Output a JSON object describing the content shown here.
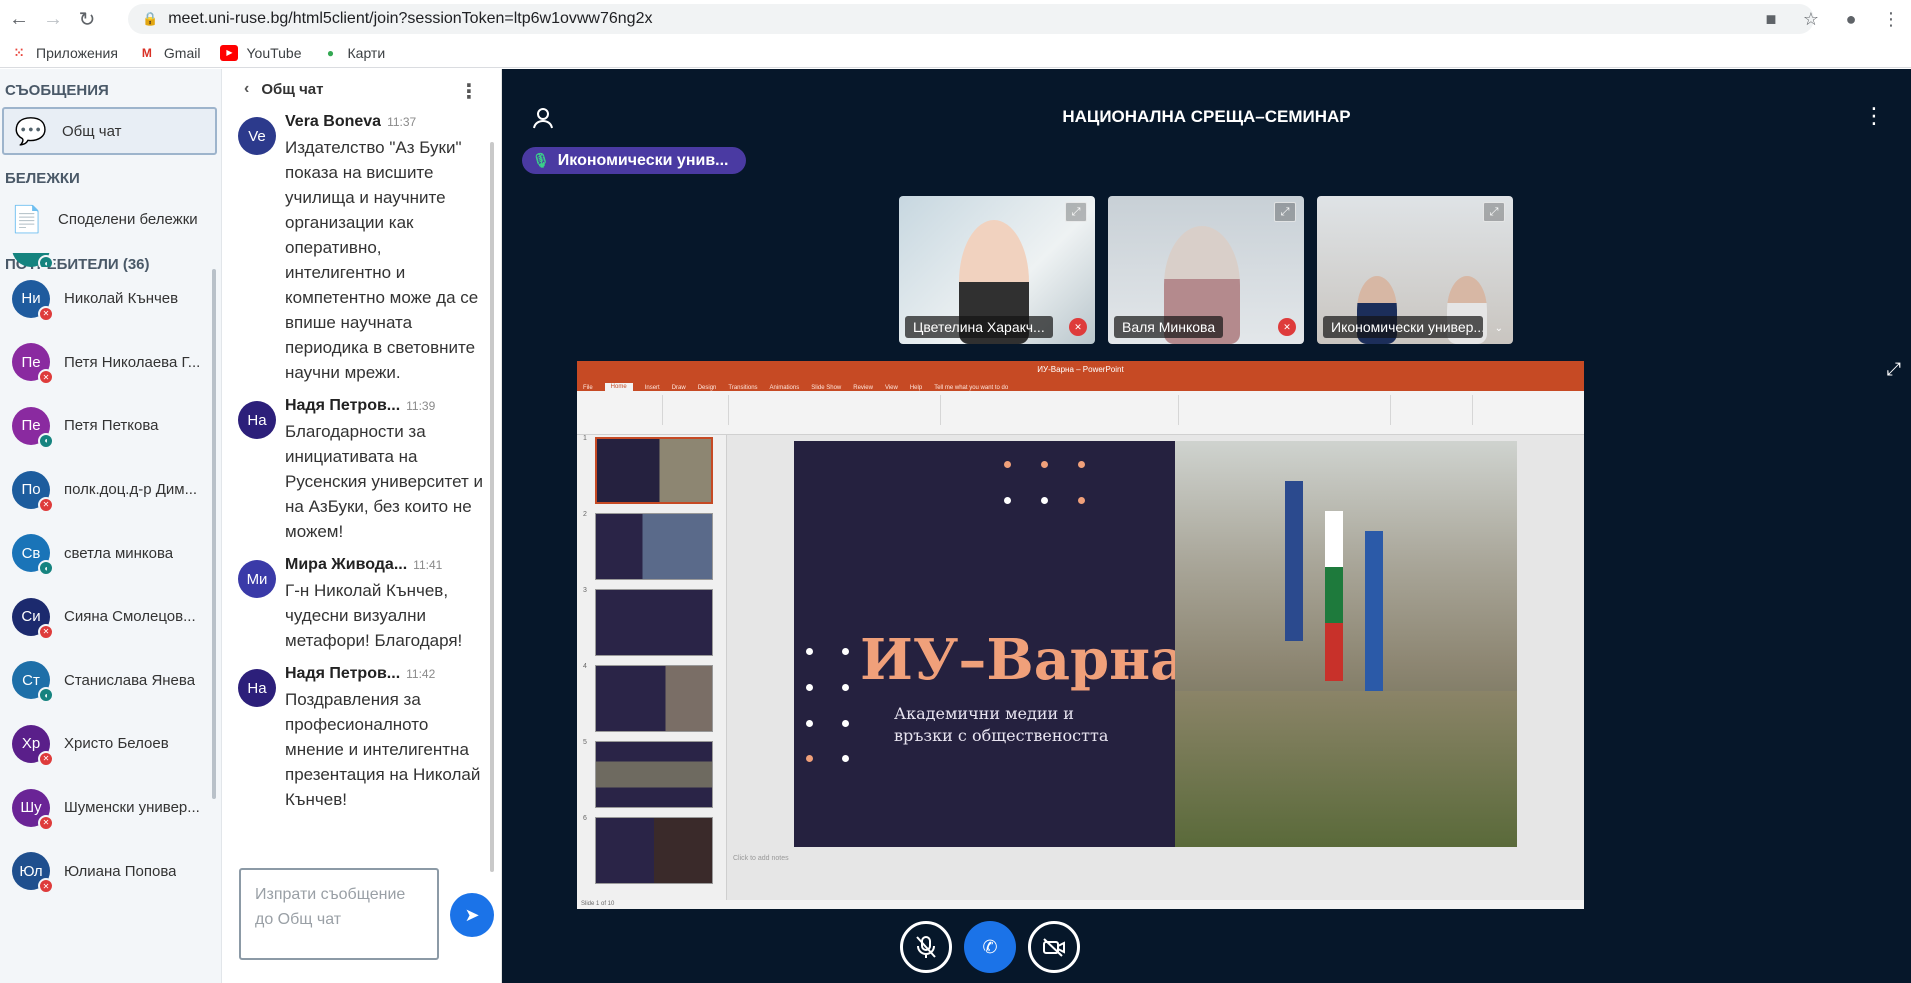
{
  "browser": {
    "url": "meet.uni-ruse.bg/html5client/join?sessionToken=ltp6w1ovww76ng2x",
    "bookmarks": [
      "Приложения",
      "Gmail",
      "YouTube",
      "Карти"
    ]
  },
  "sidebar": {
    "messages_title": "СЪОБЩЕНИЯ",
    "public_chat": "Общ чат",
    "notes_title": "БЕЛЕЖКИ",
    "shared_notes": "Споделени бележки",
    "users_title": "ПОТРЕБИТЕЛИ (36)",
    "users": [
      {
        "initials": "",
        "name": "",
        "color": "#15837f",
        "status": "listen"
      },
      {
        "initials": "Ни",
        "name": "Николай Кънчев",
        "color": "#1f5b9e",
        "status": "mic-off"
      },
      {
        "initials": "Пе",
        "name": "Петя Николаева Г...",
        "color": "#8a2aa0",
        "status": "mic-off"
      },
      {
        "initials": "Пе",
        "name": "Петя Петкова",
        "color": "#8a2aa0",
        "status": "listen"
      },
      {
        "initials": "По",
        "name": "полк.доц.д-р Дим...",
        "color": "#1d5d9e",
        "status": "mic-off"
      },
      {
        "initials": "Св",
        "name": "светла минкова",
        "color": "#1a74b8",
        "status": "listen"
      },
      {
        "initials": "Си",
        "name": "Сияна Смолецов...",
        "color": "#1c2a6e",
        "status": "mic-off"
      },
      {
        "initials": "Ст",
        "name": "Станислава Янева",
        "color": "#1e6fa8",
        "status": "listen"
      },
      {
        "initials": "Хр",
        "name": "Христо Белоев",
        "color": "#5a1f8a",
        "status": "mic-off"
      },
      {
        "initials": "Шу",
        "name": "Шуменски универ...",
        "color": "#6a2496",
        "status": "mic-off"
      },
      {
        "initials": "Юл",
        "name": "Юлиана Попова",
        "color": "#1f4f8e",
        "status": "mic-off"
      }
    ]
  },
  "chat": {
    "title": "Общ чат",
    "messages": [
      {
        "initials": "Ve",
        "author": "Vera Boneva",
        "time": "11:37",
        "text": "Издателство \"Аз Буки\" показа на висшите училища и научните организации как оперативно, интелигентно и компетентно може да се впише научната периодика в световните научни мрежи.",
        "color": "#2c3a8c"
      },
      {
        "initials": "На",
        "author": "Надя Петров...",
        "time": "11:39",
        "text": "Благодарности за инициативата на Русенския университет и на АзБуки, без които не можем!",
        "color": "#2c1f7a"
      },
      {
        "initials": "Ми",
        "author": "Мира Живода...",
        "time": "11:41",
        "text": "Г-н Николай Кънчев, чудесни визуални метафори! Благодаря!",
        "color": "#3a3aa8"
      },
      {
        "initials": "На",
        "author": "Надя Петров...",
        "time": "11:42",
        "text": "Поздравления за професионалното мнение и интелигентна презентация на Николай Кънчев!",
        "color": "#2c1f7a"
      }
    ],
    "input_placeholder": "Изпрати съобщение до Общ чат"
  },
  "main": {
    "title": "НАЦИОНАЛНА СРЕЩА–СЕМИНАР",
    "speaker": "Икономически унив...",
    "tiles": [
      {
        "name": "Цветелина Харакч..."
      },
      {
        "name": "Валя Минкова"
      },
      {
        "name": "Икономически универ..."
      }
    ],
    "presentation": {
      "window_title": "ИУ-Варна – PowerPoint",
      "tabs": [
        "File",
        "Home",
        "Insert",
        "Draw",
        "Design",
        "Transitions",
        "Animations",
        "Slide Show",
        "Review",
        "View",
        "Help",
        "Tell me what you want to do"
      ],
      "slide_title": "ИУ–Варна",
      "slide_subtitle_1": "Академични медии и",
      "slide_subtitle_2": "връзки с обществеността",
      "notes": "Click to add notes",
      "status": "Slide 1 of 10"
    }
  },
  "colors": {
    "main_bg": "#06172a",
    "accent": "#1b73e8",
    "pp_orange": "#c64a24",
    "slide_bg": "#25213f",
    "slide_title": "#f0a07a"
  }
}
